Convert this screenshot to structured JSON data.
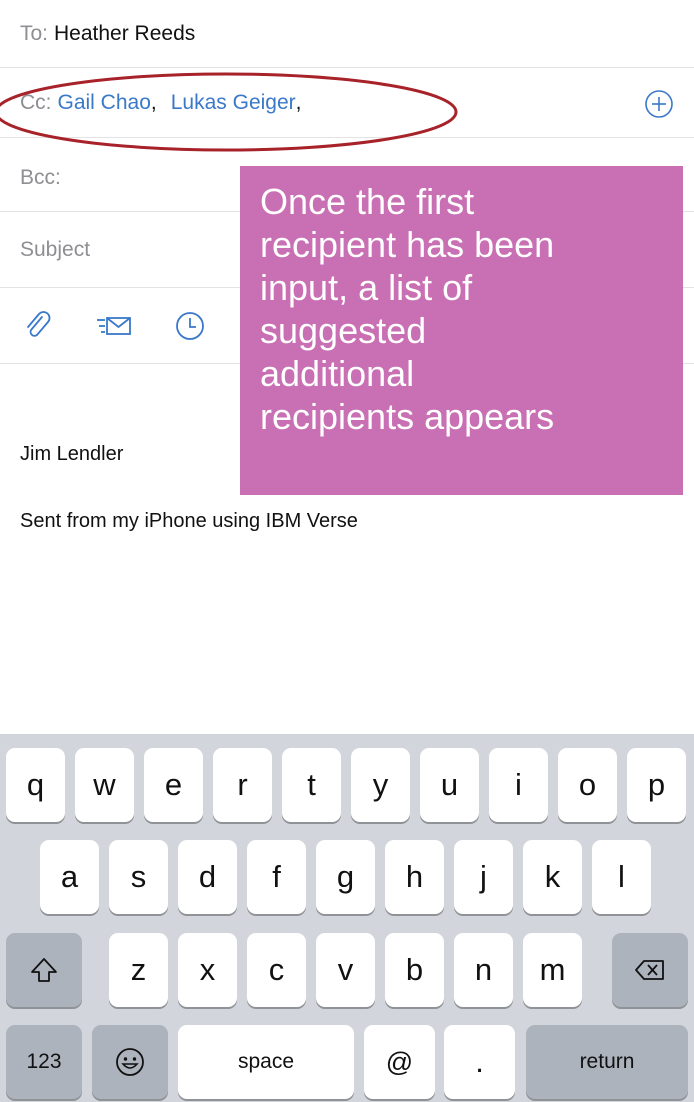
{
  "compose": {
    "to_label": "To:",
    "to_value": "Heather Reeds",
    "cc_label": "Cc:",
    "cc_recipients": [
      "Gail Chao",
      "Lukas Geiger"
    ],
    "cc_separator": ",",
    "add_icon": "plus-circle-icon",
    "bcc_label": "Bcc:",
    "subject_placeholder": "Subject",
    "toolbar_icons": [
      "paperclip-icon",
      "template-mail-icon",
      "clock-icon"
    ]
  },
  "body": {
    "signature": "Jim Lendler",
    "sent_from": "Sent from my iPhone using IBM Verse"
  },
  "annotation": {
    "callout_lines": [
      "Once the first",
      "recipient has been",
      "input, a list of",
      "suggested",
      "additional",
      "recipients appears"
    ],
    "callout_color": "#c96fb3",
    "ellipse_color": "#a8222a"
  },
  "keyboard": {
    "row1": [
      "q",
      "w",
      "e",
      "r",
      "t",
      "y",
      "u",
      "i",
      "o",
      "p"
    ],
    "row2": [
      "a",
      "s",
      "d",
      "f",
      "g",
      "h",
      "j",
      "k",
      "l"
    ],
    "row3": [
      "z",
      "x",
      "c",
      "v",
      "b",
      "n",
      "m"
    ],
    "shift_icon": "shift-icon",
    "backspace_icon": "backspace-icon",
    "numbers_label": "123",
    "emoji_icon": "emoji-icon",
    "space_label": "space",
    "at_label": "@",
    "period_label": ".",
    "return_label": "return"
  },
  "colors": {
    "link_blue": "#3a78c9",
    "label_gray": "#8e8e93",
    "keyboard_bg": "#d2d5db",
    "key_dark": "#adb3bc"
  }
}
